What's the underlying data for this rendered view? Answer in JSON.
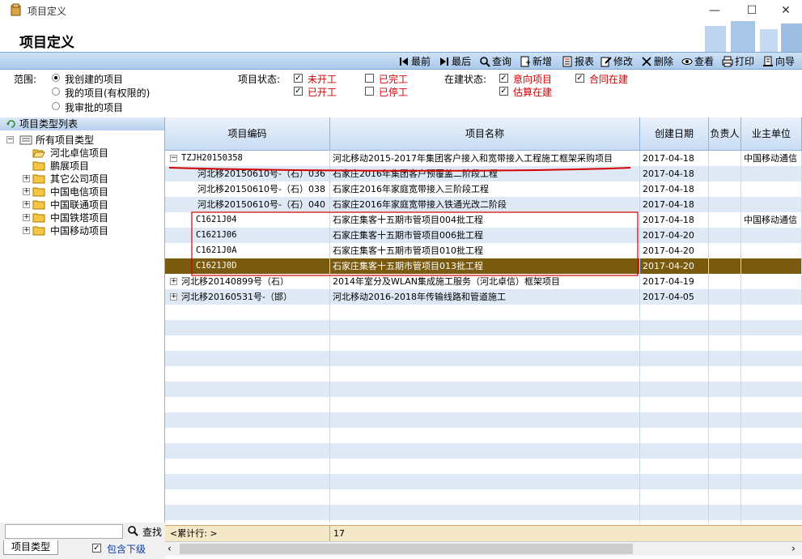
{
  "window": {
    "title": "项目定义",
    "minimize": "—",
    "maximize": "☐",
    "close": "✕"
  },
  "header": {
    "page_title": "项目定义"
  },
  "toolbar": {
    "first": "最前",
    "last": "最后",
    "query": "查询",
    "add": "新增",
    "report": "报表",
    "edit": "修改",
    "delete": "删除",
    "view": "查看",
    "print": "打印",
    "export": "向导"
  },
  "filters": {
    "scope_label": "范围:",
    "scope_options": [
      "我创建的项目",
      "我的项目(有权限的)",
      "我审批的项目"
    ],
    "status_label": "项目状态:",
    "status_options": [
      {
        "label": "未开工",
        "checked": true
      },
      {
        "label": "已完工",
        "checked": false
      },
      {
        "label": "已开工",
        "checked": true
      },
      {
        "label": "已停工",
        "checked": false
      }
    ],
    "building_label": "在建状态:",
    "building_options": [
      {
        "label": "意向项目",
        "checked": true
      },
      {
        "label": "合同在建",
        "checked": true
      },
      {
        "label": "估算在建",
        "checked": true
      }
    ]
  },
  "tree": {
    "title": "项目类型列表",
    "root": "所有项目类型",
    "items": [
      "河北卓信项目",
      "鹏展项目",
      "其它公司项目",
      "中国电信项目",
      "中国联通项目",
      "中国铁塔项目",
      "中国移动项目"
    ]
  },
  "left_bottom": {
    "search_label": "查找",
    "tab_label": "项目类型",
    "include_sub": "包含下级"
  },
  "grid": {
    "columns": [
      "项目编码",
      "项目名称",
      "创建日期",
      "负责人",
      "业主单位"
    ],
    "rows": [
      {
        "code": "TZJH20150358",
        "name": "河北移动2015-2017年集团客户接入和宽带接入工程施工框架采购项目",
        "date": "2017-04-18",
        "owner": "",
        "unit": "中国移动通信"
      },
      {
        "code": "河北移20150610号-（石）036",
        "name": "石家庄2016年集团客户预覆盖二阶段工程",
        "date": "2017-04-18",
        "owner": "",
        "unit": ""
      },
      {
        "code": "河北移20150610号-（石）038",
        "name": "石家庄2016年家庭宽带接入三阶段工程",
        "date": "2017-04-18",
        "owner": "",
        "unit": ""
      },
      {
        "code": "河北移20150610号-（石）040",
        "name": "石家庄2016年家庭宽带接入铁通光改二阶段",
        "date": "2017-04-18",
        "owner": "",
        "unit": ""
      },
      {
        "code": "C1621J04",
        "name": "石家庄集客十五期市管项目004批工程",
        "date": "2017-04-18",
        "owner": "",
        "unit": "中国移动通信"
      },
      {
        "code": "C1621J06",
        "name": "石家庄集客十五期市管项目006批工程",
        "date": "2017-04-20",
        "owner": "",
        "unit": ""
      },
      {
        "code": "C1621J0A",
        "name": "石家庄集客十五期市管项目010批工程",
        "date": "2017-04-20",
        "owner": "",
        "unit": ""
      },
      {
        "code": "C1621J0D",
        "name": "石家庄集客十五期市管项目013批工程",
        "date": "2017-04-20",
        "owner": "",
        "unit": ""
      },
      {
        "code": "河北移20140899号（石）",
        "name": "2014年室分及WLAN集成施工服务（河北卓信）框架项目",
        "date": "2017-04-19",
        "owner": "",
        "unit": ""
      },
      {
        "code": "河北移20160531号-（邯）",
        "name": "河北移动2016-2018年传输线路和管道施工",
        "date": "2017-04-05",
        "owner": "",
        "unit": ""
      }
    ],
    "footer_label": "<累计行: >",
    "footer_count": "17"
  },
  "colors": {
    "accent": "#7a5a0e",
    "annotation": "#d40000",
    "toolbar": "#b6d0ee"
  }
}
